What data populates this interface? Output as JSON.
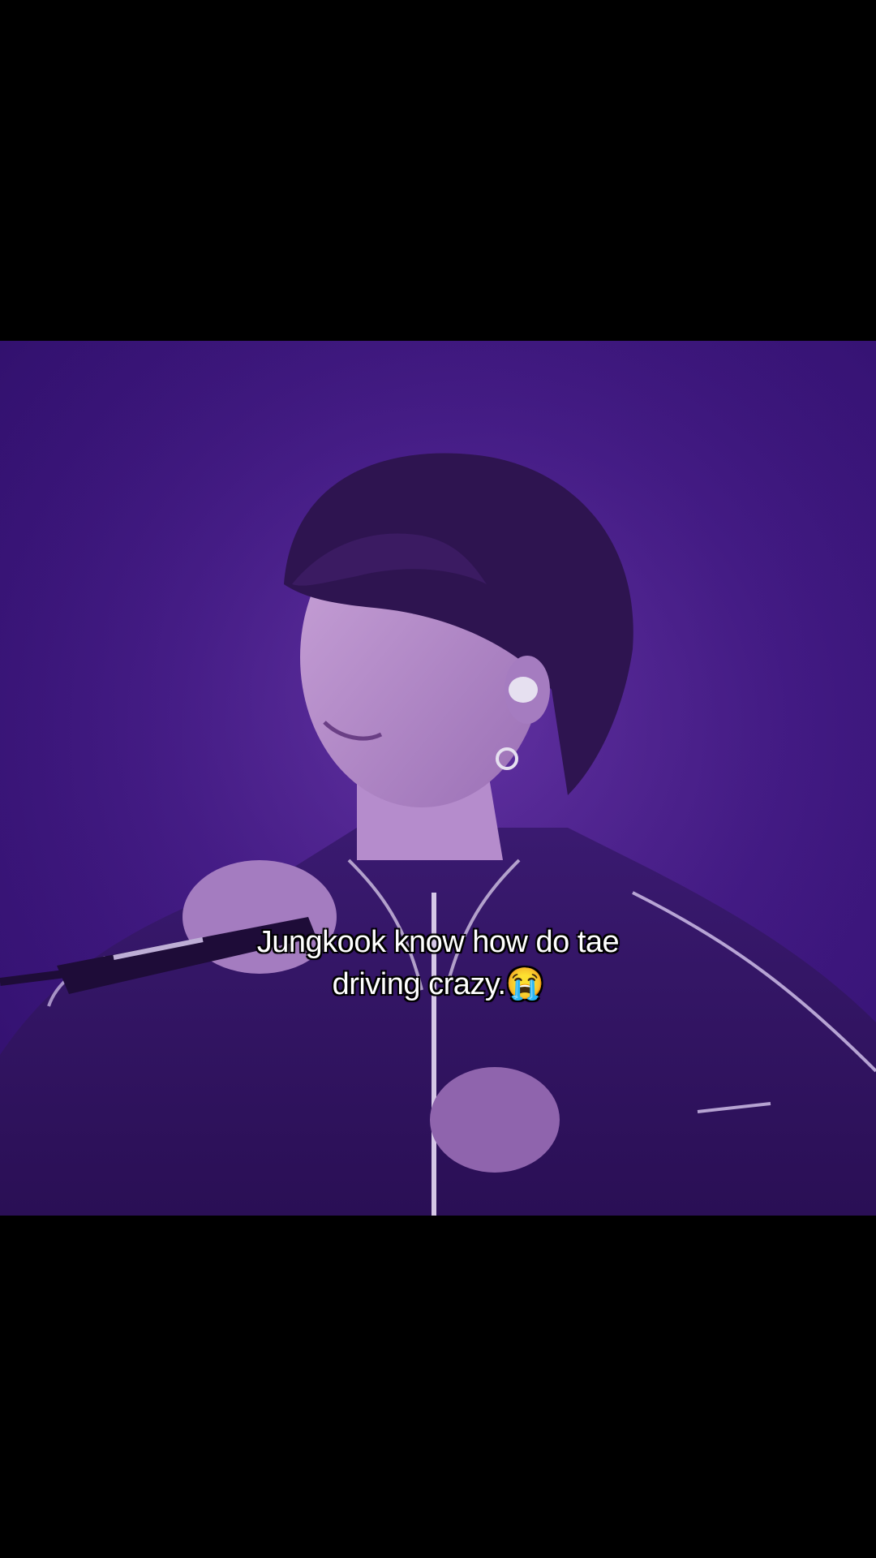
{
  "caption": {
    "line1": "Jungkook know how do tae",
    "line2": "driving crazy.😭"
  },
  "colors": {
    "letterbox": "#000000",
    "stage_purple": "#431a86",
    "caption_text": "#ffffff"
  },
  "video": {
    "description_icon": "concert-performer-image"
  }
}
